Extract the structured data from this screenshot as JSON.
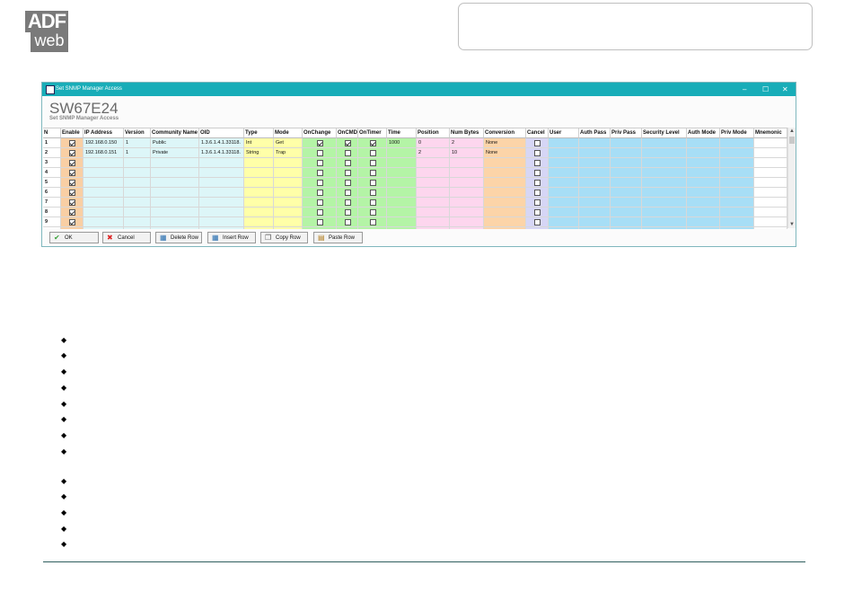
{
  "logo": {
    "line1": "ADF",
    "line2": "web"
  },
  "window": {
    "title": "Set SNMP Manager Access",
    "controls": {
      "minimize": "–",
      "maximize": "☐",
      "close": "✕"
    },
    "heading": "SW67E24",
    "subheading": "Set SNMP Manager Access"
  },
  "grid": {
    "columns": [
      "N",
      "Enable",
      "IP Address",
      "Version",
      "Community Name",
      "OID",
      "Type",
      "Mode",
      "OnChange",
      "OnCMD",
      "OnTimer",
      "Time",
      "Position",
      "Num Bytes",
      "Conversion",
      "Cancel",
      "User",
      "Auth Pass",
      "Priv Pass",
      "Security Level",
      "Auth Mode",
      "Priv Mode",
      "Mnemonic"
    ],
    "column_colors": [
      "#ffffff",
      "#f9cfa4",
      "#ddf6f8",
      "#ddf6f8",
      "#ddf6f8",
      "#ddf6f8",
      "#ffffa8",
      "#ffffa8",
      "#b4f4a6",
      "#b4f4a6",
      "#b4f4a6",
      "#b4f4a6",
      "#fdd6ee",
      "#fdd6ee",
      "#fcd4a8",
      "#d6d6f6",
      "#a7def6",
      "#a7def6",
      "#a7def6",
      "#a7def6",
      "#a7def6",
      "#a7def6",
      "#ffffff"
    ],
    "rows": [
      {
        "n": "1",
        "enable": true,
        "ip": "192.168.0.150",
        "version": "1",
        "community": "Public",
        "oid": "1.3.6.1.4.1.33118.",
        "type": "Int",
        "mode": "Get",
        "onchange": true,
        "oncmd": true,
        "ontimer": true,
        "time": "1000",
        "position": "0",
        "numbytes": "2",
        "conversion": "None",
        "cancel": false
      },
      {
        "n": "2",
        "enable": true,
        "ip": "192.168.0.151",
        "version": "1",
        "community": "Private",
        "oid": "1.3.6.1.4.1.33118.",
        "type": "String",
        "mode": "Trap",
        "onchange": false,
        "oncmd": false,
        "ontimer": false,
        "time": "",
        "position": "2",
        "numbytes": "10",
        "conversion": "None",
        "cancel": false
      },
      {
        "n": "3",
        "enable": true,
        "ip": "",
        "version": "",
        "community": "",
        "oid": "",
        "type": "",
        "mode": "",
        "onchange": false,
        "oncmd": false,
        "ontimer": false,
        "time": "",
        "position": "",
        "numbytes": "",
        "conversion": "",
        "cancel": false
      },
      {
        "n": "4",
        "enable": true,
        "ip": "",
        "version": "",
        "community": "",
        "oid": "",
        "type": "",
        "mode": "",
        "onchange": false,
        "oncmd": false,
        "ontimer": false,
        "time": "",
        "position": "",
        "numbytes": "",
        "conversion": "",
        "cancel": false
      },
      {
        "n": "5",
        "enable": true,
        "ip": "",
        "version": "",
        "community": "",
        "oid": "",
        "type": "",
        "mode": "",
        "onchange": false,
        "oncmd": false,
        "ontimer": false,
        "time": "",
        "position": "",
        "numbytes": "",
        "conversion": "",
        "cancel": false
      },
      {
        "n": "6",
        "enable": true,
        "ip": "",
        "version": "",
        "community": "",
        "oid": "",
        "type": "",
        "mode": "",
        "onchange": false,
        "oncmd": false,
        "ontimer": false,
        "time": "",
        "position": "",
        "numbytes": "",
        "conversion": "",
        "cancel": false
      },
      {
        "n": "7",
        "enable": true,
        "ip": "",
        "version": "",
        "community": "",
        "oid": "",
        "type": "",
        "mode": "",
        "onchange": false,
        "oncmd": false,
        "ontimer": false,
        "time": "",
        "position": "",
        "numbytes": "",
        "conversion": "",
        "cancel": false
      },
      {
        "n": "8",
        "enable": true,
        "ip": "",
        "version": "",
        "community": "",
        "oid": "",
        "type": "",
        "mode": "",
        "onchange": false,
        "oncmd": false,
        "ontimer": false,
        "time": "",
        "position": "",
        "numbytes": "",
        "conversion": "",
        "cancel": false
      },
      {
        "n": "9",
        "enable": true,
        "ip": "",
        "version": "",
        "community": "",
        "oid": "",
        "type": "",
        "mode": "",
        "onchange": false,
        "oncmd": false,
        "ontimer": false,
        "time": "",
        "position": "",
        "numbytes": "",
        "conversion": "",
        "cancel": false
      }
    ]
  },
  "buttons": [
    {
      "label": "OK",
      "icon": "check-icon",
      "glyph": "✔",
      "color": "#3aa33a"
    },
    {
      "label": "Cancel",
      "icon": "x-icon",
      "glyph": "✖",
      "color": "#d22"
    },
    {
      "label": "Delete Row",
      "icon": "delete-row-icon",
      "glyph": "▦",
      "color": "#2a6fb0"
    },
    {
      "label": "Insert Row",
      "icon": "insert-row-icon",
      "glyph": "▦",
      "color": "#2a6fb0"
    },
    {
      "label": "Copy Row",
      "icon": "copy-row-icon",
      "glyph": "❐",
      "color": "#555"
    },
    {
      "label": "Paste Row",
      "icon": "paste-row-icon",
      "glyph": "▤",
      "color": "#b07a1a"
    }
  ],
  "bullet_glyph": "◆",
  "bullet_count": 13
}
